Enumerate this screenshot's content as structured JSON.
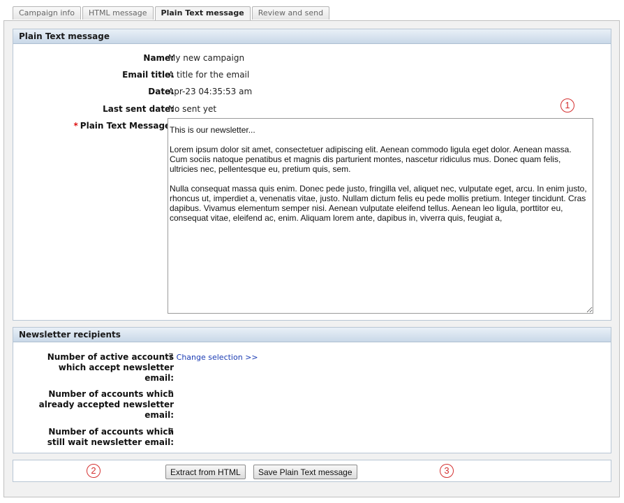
{
  "tabs": [
    {
      "label": "Campaign info",
      "active": false
    },
    {
      "label": "HTML message",
      "active": false
    },
    {
      "label": "Plain Text message",
      "active": true
    },
    {
      "label": "Review and send",
      "active": false
    }
  ],
  "message_panel": {
    "header": "Plain Text message",
    "name_label": "Name:",
    "name_value": "My new campaign",
    "email_title_label": "Email title:",
    "email_title_value": "A title for the email",
    "date_label": "Date:",
    "date_value": "Apr-23 04:35:53 am",
    "last_sent_label": "Last sent date:",
    "last_sent_value": "No sent yet",
    "required_mark": "*",
    "plain_text_label": "Plain Text Message:",
    "plain_text_value": "This is our newsletter...\n\nLorem ipsum dolor sit amet, consectetuer adipiscing elit. Aenean commodo ligula eget dolor. Aenean massa.\nCum sociis natoque penatibus et magnis dis parturient montes, nascetur ridiculus mus. Donec quam felis,\nultricies nec, pellentesque eu, pretium quis, sem.\n\nNulla consequat massa quis enim. Donec pede justo, fringilla vel, aliquet nec, vulputate eget, arcu. In enim justo,\nrhoncus ut, imperdiet a, venenatis vitae, justo. Nullam dictum felis eu pede mollis pretium. Integer tincidunt. Cras\ndapibus. Vivamus elementum semper nisi. Aenean vulputate eleifend tellus. Aenean leo ligula, porttitor eu,\nconsequat vitae, eleifend ac, enim. Aliquam lorem ante, dapibus in, viverra quis, feugiat a,"
  },
  "recipients_panel": {
    "header": "Newsletter recipients",
    "active_label_lines": [
      "Number of active accounts",
      "which accept newsletter",
      "email:"
    ],
    "active_value": "7",
    "change_selection": "Change selection >>",
    "accepted_label_lines": [
      "Number of accounts which",
      "already accepted newsletter",
      "email:"
    ],
    "accepted_value": "0",
    "waiting_label_lines": [
      "Number of accounts which",
      "still wait newsletter email:"
    ],
    "waiting_value": "7"
  },
  "actions": {
    "extract_button": "Extract from HTML",
    "save_button": "Save Plain Text message"
  },
  "markers": [
    "1",
    "2",
    "3"
  ],
  "colors": {
    "panel_header_top": "#e9f0f7",
    "panel_header_bottom": "#c9d8e8",
    "link": "#1a3bb3",
    "required": "#d11",
    "marker": "#d43030"
  }
}
